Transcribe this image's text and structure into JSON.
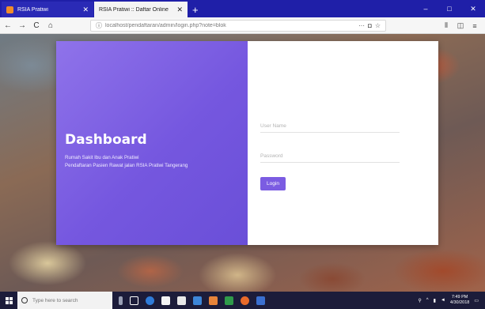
{
  "browser": {
    "tabs": [
      {
        "title": "RSIA Pratiwi",
        "active": false
      },
      {
        "title": "RSIA Pratiwi :: Daftar Online",
        "active": true
      }
    ],
    "url": "localhost/pendaftaran/admin/login.php?note=blok",
    "nav": {
      "back": "←",
      "forward": "→",
      "reload": "C",
      "home": "⌂"
    },
    "url_actions": {
      "more": "···",
      "pocket": "◘",
      "bookmark": "☆"
    },
    "toolbar_right": {
      "library": "⫴",
      "sidebar": "◫",
      "menu": "≡"
    },
    "window_controls": {
      "minimize": "–",
      "maximize": "□",
      "close": "✕"
    }
  },
  "login": {
    "heading": "Dashboard",
    "subtitle_1": "Rumah Sakit Ibu dan Anak Pratiwi",
    "subtitle_2": "Pendaftaran Pasien Rawat jalan RSIA Pratiwi Tangerang",
    "username_placeholder": "User Name",
    "password_placeholder": "Password",
    "login_button": "Login"
  },
  "taskbar": {
    "search_placeholder": "Type here to search",
    "time": "7:49 PM",
    "date": "4/30/2018",
    "app_icons": [
      "microphone-icon",
      "task-view-icon",
      "edge-icon",
      "store-icon",
      "mail-icon",
      "files-icon",
      "powerpoint-icon",
      "dreamweaver-icon",
      "firefox-icon",
      "word-icon"
    ]
  },
  "colors": {
    "accent": "#7557df",
    "tab_bar": "#1f1fa8"
  }
}
